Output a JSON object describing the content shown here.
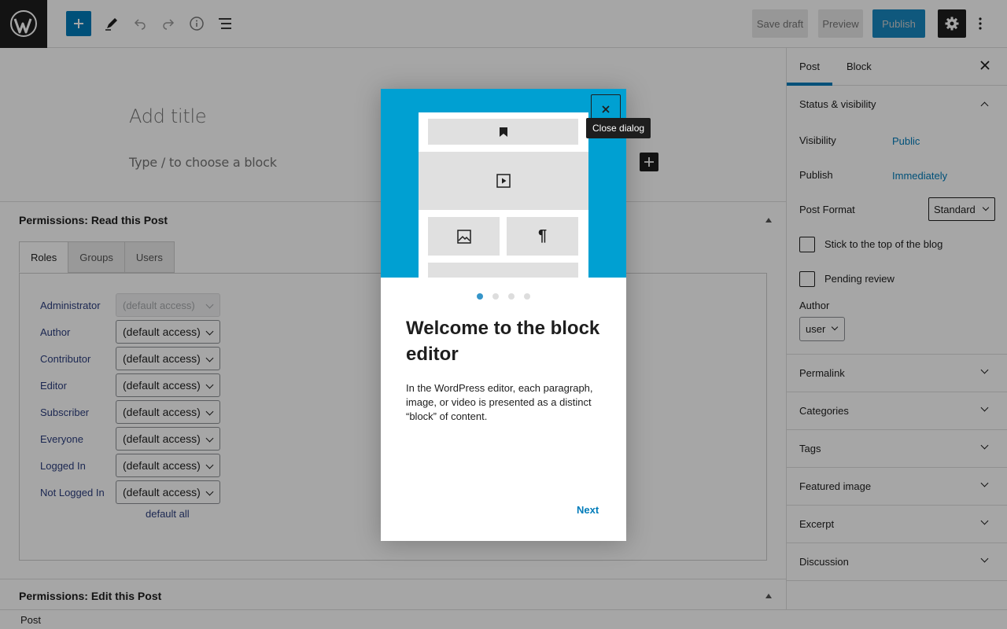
{
  "toolbar": {
    "save_draft": "Save draft",
    "preview": "Preview",
    "publish": "Publish"
  },
  "editor": {
    "title_placeholder": "Add title",
    "block_placeholder": "Type / to choose a block"
  },
  "metabox_read": {
    "title": "Permissions: Read this Post",
    "tabs": [
      "Roles",
      "Groups",
      "Users"
    ],
    "roles": [
      {
        "label": "Administrator",
        "value": "(default access)"
      },
      {
        "label": "Author",
        "value": "(default access)"
      },
      {
        "label": "Contributor",
        "value": "(default access)"
      },
      {
        "label": "Editor",
        "value": "(default access)"
      },
      {
        "label": "Subscriber",
        "value": "(default access)"
      },
      {
        "label": "Everyone",
        "value": "(default access)"
      },
      {
        "label": "Logged In",
        "value": "(default access)"
      },
      {
        "label": "Not Logged In",
        "value": "(default access)"
      }
    ],
    "default_all": "default all"
  },
  "metabox_edit": {
    "title": "Permissions: Edit this Post"
  },
  "statusbar": {
    "breadcrumb": "Post"
  },
  "sidebar": {
    "tabs": [
      "Post",
      "Block"
    ],
    "status_visibility": {
      "title": "Status & visibility",
      "visibility_label": "Visibility",
      "visibility_value": "Public",
      "publish_label": "Publish",
      "publish_value": "Immediately",
      "format_label": "Post Format",
      "format_value": "Standard",
      "sticky_label": "Stick to the top of the blog",
      "pending_label": "Pending review",
      "author_label": "Author",
      "author_value": "user"
    },
    "panels": [
      "Permalink",
      "Categories",
      "Tags",
      "Featured image",
      "Excerpt",
      "Discussion"
    ]
  },
  "modal": {
    "close_tooltip": "Close dialog",
    "heading": "Welcome to the block editor",
    "body": "In the WordPress editor, each paragraph, image, or video is presented as a distinct “block” of content.",
    "next": "Next",
    "page_count": 4,
    "current_page": 1
  },
  "colors": {
    "accent": "#007cba",
    "hero": "#00a0d2",
    "dark": "#1e1e1e"
  }
}
